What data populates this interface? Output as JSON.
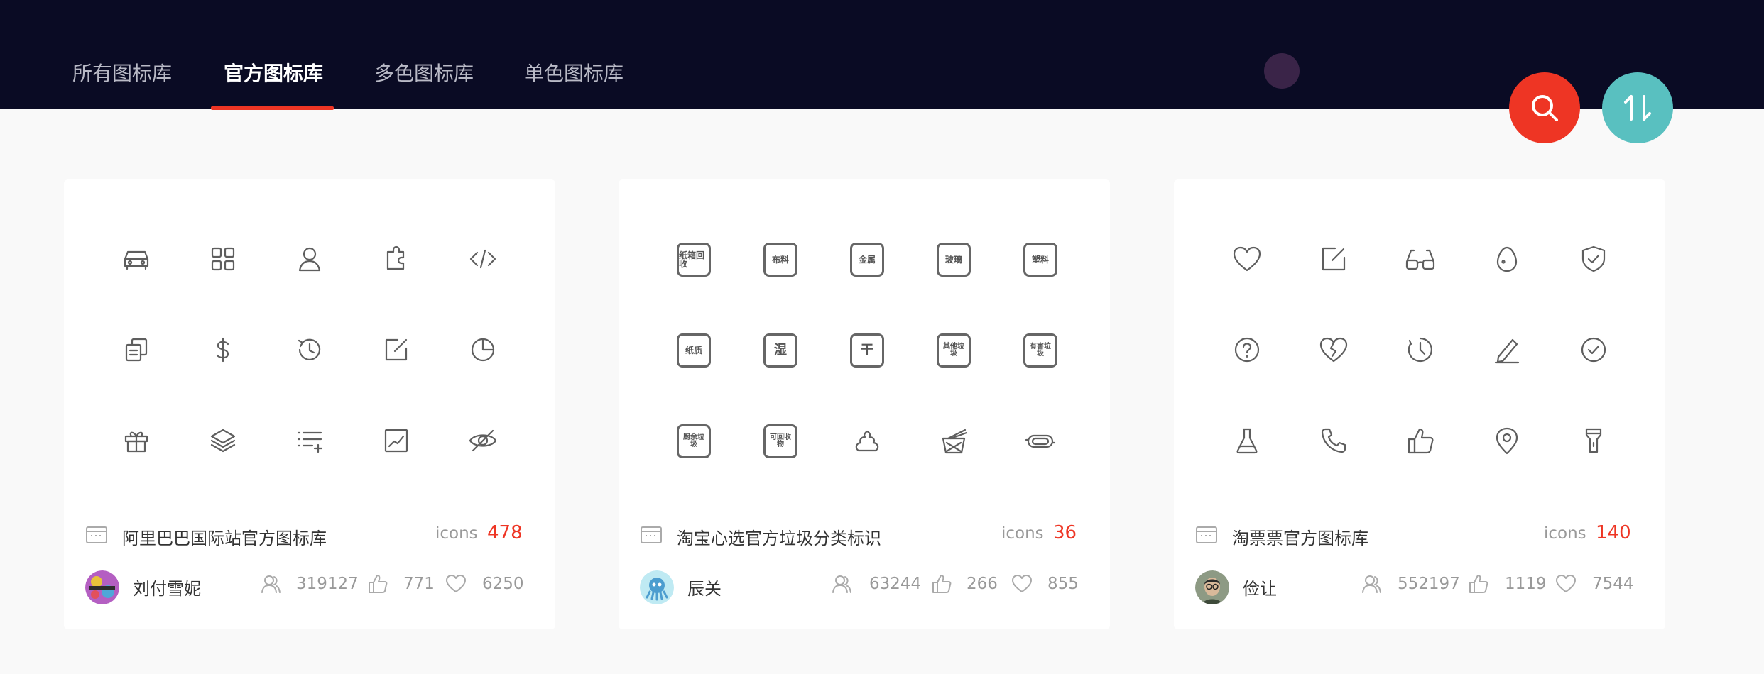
{
  "tabs": [
    {
      "label": "所有图标库"
    },
    {
      "label": "官方图标库"
    },
    {
      "label": "多色图标库"
    },
    {
      "label": "单色图标库"
    }
  ],
  "active_tab": "官方图标库",
  "colors": {
    "accent": "#ee3524",
    "header_bg": "#0a0b24",
    "sort_button": "#59c0c0"
  },
  "actions": {
    "search_icon": "search-icon",
    "sort_icon": "sort-icon"
  },
  "cards": [
    {
      "title": "阿里巴巴国际站官方图标库",
      "icons_label": "icons",
      "icons_count": "478",
      "author": "刘付雪妮",
      "followers": "319127",
      "likes": "771",
      "favorites": "6250",
      "preview_icons": [
        "car-icon",
        "apps-icon",
        "user-icon",
        "puzzle-icon",
        "code-icon",
        "copy-icon",
        "dollar-icon",
        "history-icon",
        "edit-icon",
        "pie-chart-icon",
        "gift-icon",
        "layers-icon",
        "list-add-icon",
        "chart-icon",
        "eye-off-icon"
      ]
    },
    {
      "title": "淘宝心选官方垃圾分类标识",
      "icons_label": "icons",
      "icons_count": "36",
      "author": "辰关",
      "followers": "63244",
      "likes": "266",
      "favorites": "855",
      "preview_icons": [
        "纸箱回收",
        "布料",
        "金属",
        "玻璃",
        "塑料",
        "纸质",
        "湿",
        "干",
        "其他垃圾",
        "有害垃圾",
        "厨余垃圾",
        "可回收物",
        "poop-icon",
        "noodle-box-icon",
        "pad-icon"
      ]
    },
    {
      "title": "淘票票官方图标库",
      "icons_label": "icons",
      "icons_count": "140",
      "author": "俭让",
      "followers": "552197",
      "likes": "1119",
      "favorites": "7544",
      "preview_icons": [
        "heart-icon",
        "edit-icon",
        "glasses-icon",
        "egg-icon",
        "shield-check-icon",
        "question-icon",
        "broken-heart-icon",
        "clock-icon",
        "pen-icon",
        "check-circle-icon",
        "flask-icon",
        "phone-icon",
        "thumbs-up-icon",
        "location-icon",
        "flashlight-icon"
      ]
    }
  ]
}
